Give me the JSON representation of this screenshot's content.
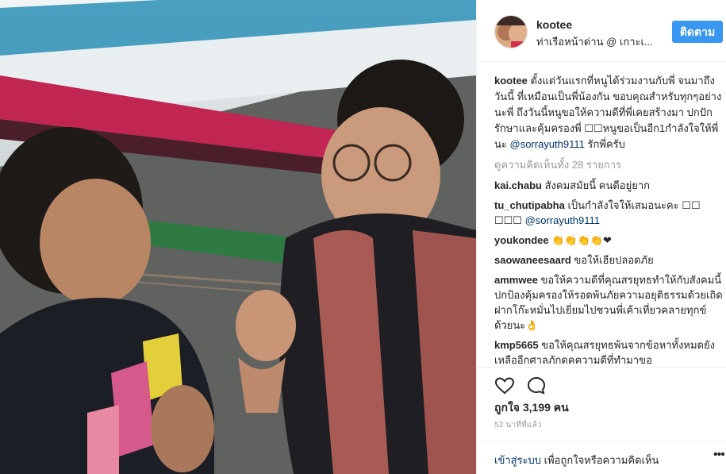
{
  "post": {
    "username": "kootee",
    "location": "ท่าเรือหน้าด่าน @ เกาะเ...",
    "follow_label": "ติดตาม",
    "caption_text": "ตั้งแต่วันแรกที่หนูได้ร่วมงานกับพี่ จนมาถึงวันนี้ ที่เหมือนเป็นพี่น้องกัน ขอบคุณสำหรับทุกๆอย่างนะพี่ ถึงวันนี้หนูขอให้ความดีที่พี่เคยสร้างมา ปกปักรักษาและคุ้มครองพี่ ☐☐หนูขอเป็นอีก1กำลังใจให้พี่นะ",
    "caption_mention": "@sorrayuth9111",
    "caption_end": "รักพี่ครับ",
    "view_all_comments": "ดูความคิดเห็นทั้ง 28 รายการ",
    "likes": "ถูกใจ 3,199 คน",
    "time_ago": "52 นาทีที่แล้ว"
  },
  "comments": [
    {
      "user": "kai.chabu",
      "text": "สังคมสมัยนี้ คนดีอยู่ยาก"
    },
    {
      "user": "tu_chutipabha",
      "text": "เป็นกำลังใจให้เสมอนะคะ ☐☐ ☐☐☐",
      "mention": "@sorrayuth9111"
    },
    {
      "user": "youkondee",
      "text": "👏👏👏👏❤"
    },
    {
      "user": "saowaneesaard",
      "text": "ขอให้เฮียปลอดภัย"
    },
    {
      "user": "ammwee",
      "text": "ขอให้ความดีที่คุณสรยุทธทำให้กับสังคมนี้ปกป้องคุ้มครองให้รอดพ้นภัยความอยุติธรรมด้วยเถิด ฝากโก๊ะหมั่นไปเยี่ยมไปชวนพี่เค้าเที่ยวคลายทุกข์ด้วยนะ👌"
    },
    {
      "user": "kmp5665",
      "text": "ขอให้คุณสรยุทธพ้นจากข้อหาทั้งหมดยังเหลืออีกศาลภักดคความดีที่ทำมาขอ"
    }
  ],
  "footer": {
    "login_link": "เข้าสู่ระบบ",
    "login_rest": " เพื่อถูกใจหรือความคิดเห็น",
    "more": "•••"
  },
  "icons": {
    "like": "heart-icon",
    "comment": "comment-icon",
    "more": "more-options-icon"
  },
  "colors": {
    "accent": "#3897f0",
    "link": "#003569",
    "muted": "#999999"
  }
}
